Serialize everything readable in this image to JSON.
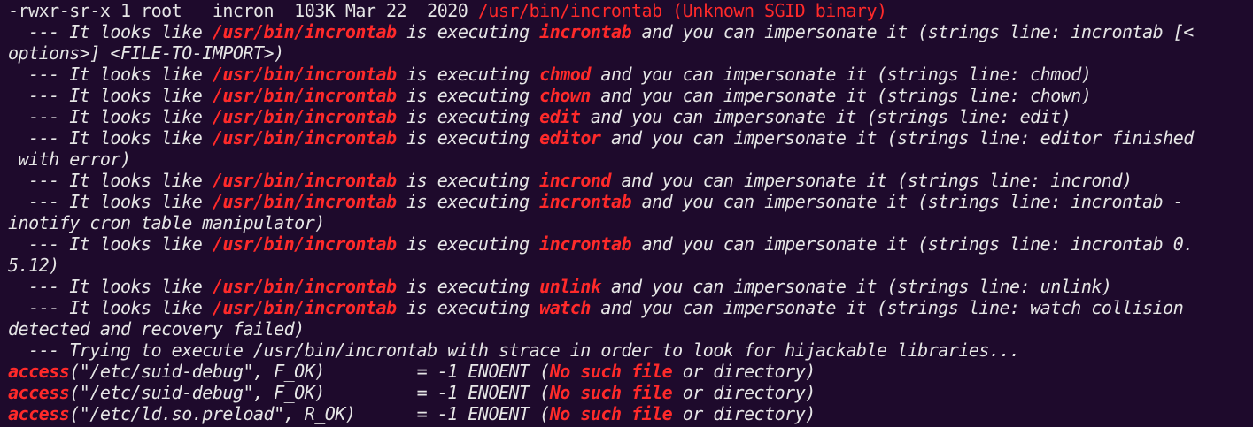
{
  "colors": {
    "background": "#1e0a2c",
    "text": "#e6e6e6",
    "highlight_red": "#ff2a2a"
  },
  "header": {
    "perms_text": "-rwxr-sr-x 1 root   incron  103K Mar 22  2020 ",
    "path_text": "/usr/bin/incrontab (Unknown SGID binary)"
  },
  "hint": {
    "prefix": "  --- It looks like ",
    "binary": "/usr/bin/incrontab",
    "middle": " is executing ",
    "suffix_start": " and you can impersonate it (strings line: "
  },
  "impersonations": [
    {
      "cmd": "incrontab",
      "line1_tail": "incrontab [<",
      "line2": "options>] <FILE-TO-IMPORT>)"
    },
    {
      "cmd": "chmod",
      "line1_tail": "chmod)",
      "line2": ""
    },
    {
      "cmd": "chown",
      "line1_tail": "chown)",
      "line2": ""
    },
    {
      "cmd": "edit",
      "line1_tail": "edit)",
      "line2": ""
    },
    {
      "cmd": "editor",
      "line1_tail": "editor finished",
      "line2": " with error)"
    },
    {
      "cmd": "incrond",
      "line1_tail": "incrond)",
      "line2": ""
    },
    {
      "cmd": "incrontab",
      "line1_tail": "incrontab -",
      "line2": "inotify cron table manipulator)"
    },
    {
      "cmd": "incrontab",
      "line1_tail": "incrontab 0.",
      "line2": "5.12)"
    },
    {
      "cmd": "unlink",
      "line1_tail": "unlink)",
      "line2": ""
    },
    {
      "cmd": "watch",
      "line1_tail": "watch collision",
      "line2": "detected and recovery failed)"
    }
  ],
  "strace_line": "  --- Trying to execute /usr/bin/incrontab with strace in order to look for hijackable libraries...",
  "strace_calls": [
    {
      "fn": "access",
      "args": "(\"/etc/suid-debug\", F_OK)",
      "pad": "         ",
      "result": "= -1 ENOENT (",
      "err": "No such file",
      "tail": " or directory)"
    },
    {
      "fn": "access",
      "args": "(\"/etc/suid-debug\", F_OK)",
      "pad": "         ",
      "result": "= -1 ENOENT (",
      "err": "No such file",
      "tail": " or directory)"
    },
    {
      "fn": "access",
      "args": "(\"/etc/ld.so.preload\", R_OK)",
      "pad": "      ",
      "result": "= -1 ENOENT (",
      "err": "No such file",
      "tail": " or directory)"
    }
  ]
}
